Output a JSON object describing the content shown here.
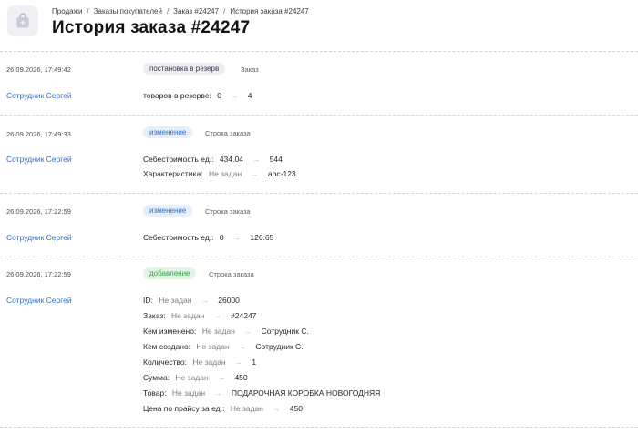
{
  "breadcrumb": [
    "Продажи",
    "Заказы покупателей",
    "Заказ #24247",
    "История заказа #24247"
  ],
  "title": "История заказа #24247",
  "entries": [
    {
      "timestamp": "26.09.2026, 17:49:42",
      "badge": "постановка в резерв",
      "tag": "Заказ",
      "user": "Сотрудник Сергей",
      "changes": [
        {
          "label": "товаров в резерве:",
          "from": "0",
          "to": "4"
        }
      ]
    },
    {
      "timestamp": "26.09.2026, 17:49:33",
      "badge": "изменение",
      "tag": "Строка заказа",
      "user": "Сотрудник Сергей",
      "changes": [
        {
          "label": "Себестоимость ед.:",
          "from": "434.04",
          "to": "544"
        },
        {
          "label": "Характеристика:",
          "from": "Не задан",
          "to": "abc-123"
        }
      ]
    },
    {
      "timestamp": "26.09.2026, 17:22:59",
      "badge": "изменение",
      "tag": "Строка заказа",
      "user": "Сотрудник Сергей",
      "changes": [
        {
          "label": "Себестоимость ед.:",
          "from": "0",
          "to": "126.65"
        }
      ]
    },
    {
      "timestamp": "26.09.2026, 17:22:59",
      "badge": "добавление",
      "tag": "Строка заказа",
      "user": "Сотрудник Сергей",
      "changes": [
        {
          "label": "ID:",
          "from": "Не задан",
          "to": "26000"
        },
        {
          "label": "Заказ:",
          "from": "Не задан",
          "to": "#24247"
        },
        {
          "label": "Кем изменено:",
          "from": "Не задан",
          "to": "Сотрудник С."
        },
        {
          "label": "Кем создано:",
          "from": "Не задан",
          "to": "Сотрудник С."
        },
        {
          "label": "Количество:",
          "from": "Не задан",
          "to": "1"
        },
        {
          "label": "Сумма:",
          "from": "Не задан",
          "to": "450"
        },
        {
          "label": "Товар:",
          "from": "Не задан",
          "to": "ПОДАРОЧНАЯ КОРОБКА НОВОГОДНЯЯ"
        },
        {
          "label": "Цена по прайсу за ед.:",
          "from": "Не задан",
          "to": "450"
        }
      ]
    }
  ]
}
